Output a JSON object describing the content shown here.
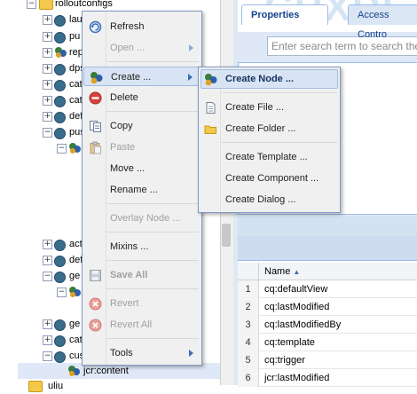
{
  "tree": {
    "root_label": "rolloutconfigs",
    "rows": [
      {
        "label": "lau"
      },
      {
        "label": "pu"
      },
      {
        "label": "rep"
      },
      {
        "label": "dps"
      },
      {
        "label": "cat"
      },
      {
        "label": "cat"
      },
      {
        "label": "def"
      },
      {
        "label": "pus"
      },
      {
        "label": "act"
      },
      {
        "label": "def"
      },
      {
        "label": "ge"
      },
      {
        "label": "ge"
      },
      {
        "label": "cat"
      },
      {
        "label": "cus"
      }
    ],
    "selected_label": "jcr:content",
    "bottom_partial": "uliu"
  },
  "search": {
    "placeholder": "Enter search term to search the"
  },
  "tabs": [
    {
      "label": "Properties",
      "active": true
    },
    {
      "label": "Access Contro",
      "active": false
    }
  ],
  "grid": {
    "column_name": "Name",
    "sort_indicator": "▲",
    "rows": [
      {
        "num": "1",
        "value": "cq:defaultView"
      },
      {
        "num": "2",
        "value": "cq:lastModified"
      },
      {
        "num": "3",
        "value": "cq:lastModifiedBy"
      },
      {
        "num": "4",
        "value": "cq:template"
      },
      {
        "num": "5",
        "value": "cq:trigger"
      },
      {
        "num": "6",
        "value": "jcr:lastModified"
      }
    ]
  },
  "context_menu": {
    "items": [
      {
        "label": "Refresh",
        "icon": "refresh-icon",
        "enabled": true
      },
      {
        "label": "Open ...",
        "icon": "",
        "enabled": false,
        "submenu": true
      },
      {
        "label": "Create ...",
        "icon": "create-icon",
        "enabled": true,
        "submenu": true,
        "hover": true
      },
      {
        "label": "Delete",
        "icon": "delete-icon",
        "enabled": true
      },
      {
        "label": "Copy",
        "icon": "copy-icon",
        "enabled": true
      },
      {
        "label": "Paste",
        "icon": "paste-icon",
        "enabled": false
      },
      {
        "label": "Move ...",
        "icon": "",
        "enabled": true
      },
      {
        "label": "Rename ...",
        "icon": "",
        "enabled": true
      },
      {
        "label": "Overlay Node ...",
        "icon": "",
        "enabled": false
      },
      {
        "label": "Mixins ...",
        "icon": "",
        "enabled": true
      },
      {
        "label": "Save All",
        "icon": "save-icon",
        "enabled": false
      },
      {
        "label": "Revert",
        "icon": "revert-icon",
        "enabled": false
      },
      {
        "label": "Revert All",
        "icon": "revert-all-icon",
        "enabled": false
      },
      {
        "label": "Tools",
        "icon": "",
        "enabled": true,
        "submenu": true
      }
    ]
  },
  "create_submenu": {
    "items": [
      {
        "label": "Create Node ...",
        "icon": "node-icon",
        "hover": true
      },
      {
        "label": "Create File ...",
        "icon": "file-icon"
      },
      {
        "label": "Create Folder ...",
        "icon": "folder-icon"
      },
      {
        "label": "Create Template ...",
        "icon": ""
      },
      {
        "label": "Create Component ...",
        "icon": ""
      },
      {
        "label": "Create Dialog ...",
        "icon": ""
      }
    ]
  },
  "colors": {
    "accent": "#15428b",
    "panel_bg": "#dfe8f6",
    "menu_bg": "#f0f0f0",
    "hover_bg": "#d8e4f3"
  }
}
